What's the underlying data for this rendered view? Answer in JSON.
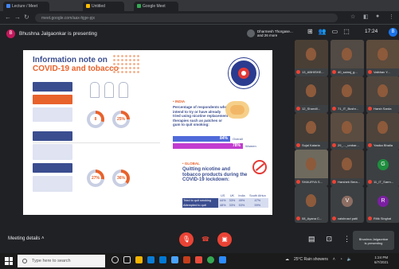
{
  "browser": {
    "tabs": [
      "Lecture / Meet",
      "Untitled",
      "Google Meet"
    ],
    "url": "meet.google.com/aax-hjge-pjx"
  },
  "meet": {
    "presenting_text": "Bhushna Jalgaonkar is presenting",
    "presenter_initial": "B",
    "notification_name": "Dharmesh Thorgase...",
    "notification_more": "and 26 more",
    "time": "17:24",
    "user_initial": "B",
    "meeting_details": "Meeting details",
    "self_tile_name": "Bhushna Jalgaonkar",
    "self_tile_status": "is presenting"
  },
  "slide": {
    "title_line1": "Information note on",
    "title_line2": "COVID-19 and tobacco",
    "donut_values": [
      "8",
      "25%"
    ],
    "donut_values_2": [
      "27%",
      "36%"
    ],
    "india_label": "• INDIA",
    "india_text": "Percentage of respondents who intend to try or have already tried using nicotine replacement therapies such as patches or gum to quit smoking:",
    "bar_values": [
      "84%",
      "78%"
    ],
    "bar_labels": [
      "Overall",
      "Women"
    ],
    "global_label": "• GLOBAL",
    "global_text": "Quitting nicotine and tobacco products during the COVID-19 lockdown:",
    "table_header": [
      "",
      "US",
      "UK",
      "India",
      "South Africa"
    ],
    "table_rows": [
      {
        "label": "Tried to quit smoking",
        "values": [
          "44%",
          "33%",
          "49%",
          "47%",
          "46%"
        ]
      },
      {
        "label": "Attempted to quit",
        "values": [
          "48%",
          "33%",
          "53%",
          "59%",
          "53%"
        ]
      }
    ]
  },
  "participants": [
    {
      "name": "13_ABHISHE...",
      "initial": ""
    },
    {
      "name": "40_sainsj_g...",
      "initial": ""
    },
    {
      "name": "Vaibhav Y...",
      "initial": ""
    },
    {
      "name": "12_Sharvill...",
      "initial": ""
    },
    {
      "name": "71_IT_Bushr...",
      "initial": ""
    },
    {
      "name": "Harsh Sarda",
      "initial": ""
    },
    {
      "name": "Sujal Kataria",
      "initial": ""
    },
    {
      "name": "29_..._umbar...",
      "initial": ""
    },
    {
      "name": "Yasika Bhalla",
      "initial": ""
    },
    {
      "name": "SHAURYA S...",
      "initial": ""
    },
    {
      "name": "Harsheb Bera...",
      "initial": ""
    },
    {
      "name": "11_IT_Sarm...",
      "initial": "G"
    },
    {
      "name": "08_Ayana C...",
      "initial": ""
    },
    {
      "name": "vaishnavi patil",
      "initial": "V"
    },
    {
      "name": "Ritik Singhal",
      "initial": "R"
    }
  ],
  "taskbar": {
    "search_placeholder": "Type here to search",
    "weather": "25°C  Rain showers",
    "time": "1:24 PM",
    "date": "6/7/2021"
  },
  "colors": {
    "accent_orange": "#e8622c",
    "slide_blue": "#3a4d8f",
    "end_call_red": "#ea4335",
    "bar_blue": "#4f6ad9",
    "bar_magenta": "#c23ccf"
  }
}
